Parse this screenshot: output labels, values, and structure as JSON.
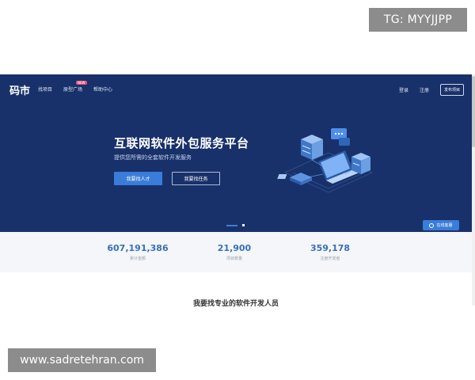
{
  "watermarks": {
    "top_right": "TG: MYYJJPP",
    "bottom_left": "www.sadretehran.com"
  },
  "nav": {
    "logo": "码市",
    "links": [
      {
        "label": "找项目"
      },
      {
        "label": "原型广场",
        "badge": "NEW"
      },
      {
        "label": "帮助中心"
      }
    ],
    "login": "登录",
    "register": "注册",
    "publish": "发布项目"
  },
  "hero": {
    "title": "互联网软件外包服务平台",
    "subtitle": "提供您所需的全套软件开发服务",
    "primary_button": "我要找人才",
    "secondary_button": "我要找任务",
    "carousel": {
      "total": 2,
      "active": 1
    }
  },
  "stats": [
    {
      "value": "607,191,386",
      "label": "累计金额"
    },
    {
      "value": "21,900",
      "label": "项目数量"
    },
    {
      "value": "359,178",
      "label": "注册开发者"
    }
  ],
  "section": {
    "title": "我要找专业的软件开发人员"
  },
  "float_button": {
    "label": "在线客服"
  },
  "colors": {
    "hero_bg": "#18316a",
    "accent": "#3a7cd9",
    "stats_bg": "#f4f6f9",
    "stat_value": "#3a6fb7"
  }
}
